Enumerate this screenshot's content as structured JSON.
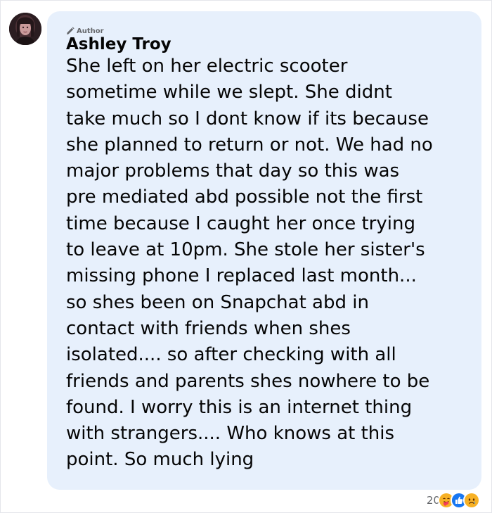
{
  "comment": {
    "badge_label": "Author",
    "badge_icon": "pencil-icon",
    "author_name": "Ashley Troy",
    "lines": [
      "She left on her electric scooter",
      "sometime while we slept. She didnt",
      "take much so I dont know if its because",
      "she planned to return or not. We had no",
      "major problems that day so this was",
      "pre mediated abd possible not the first",
      "time because I caught her once trying",
      "to leave at 10pm. She stole her sister's",
      "missing phone I replaced last month...",
      "so shes been on Snapchat abd in",
      "contact with friends when shes",
      "isolated.... so after checking with all",
      "friends and parents shes nowhere to be",
      "found. I worry this is an internet thing",
      "with strangers.... Who knows at this",
      "point. So much lying"
    ]
  },
  "reactions": {
    "count": "20",
    "icons": [
      "care-emoji-icon",
      "like-icon",
      "sad-emoji-icon"
    ],
    "colors": {
      "care": "#f7b125",
      "like": "#1877f2",
      "sad": "#f7b125"
    }
  },
  "colors": {
    "bubble": "#e7f0fc",
    "text": "#050505",
    "muted": "#65676b"
  }
}
